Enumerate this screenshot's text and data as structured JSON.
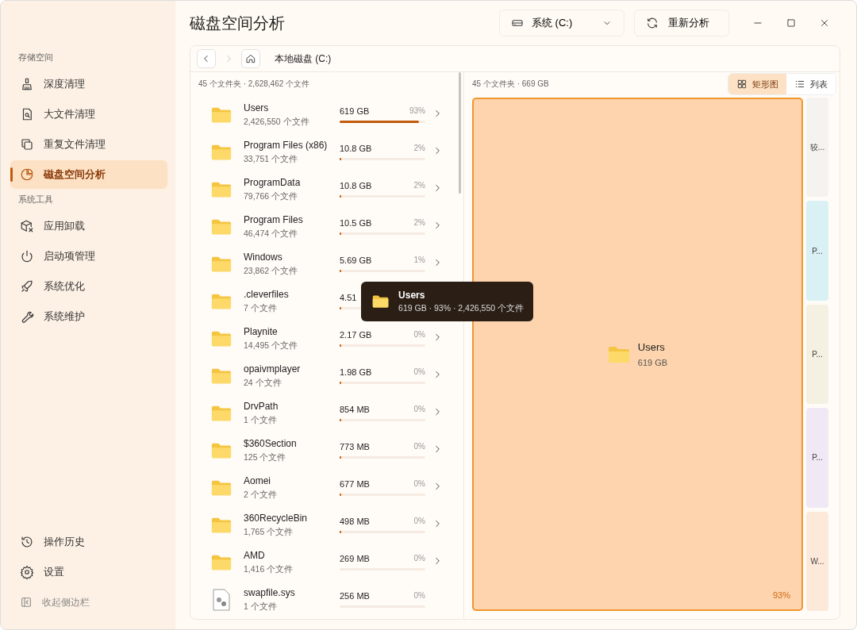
{
  "window": {
    "title": "磁盘空间分析"
  },
  "drive_select": {
    "value": "系统 (C:)"
  },
  "rescan_button": {
    "label": "重新分析"
  },
  "sidebar": {
    "sections": [
      {
        "header": "存储空间",
        "items": [
          {
            "label": "深度清理",
            "selected": false
          },
          {
            "label": "大文件清理",
            "selected": false
          },
          {
            "label": "重复文件清理",
            "selected": false
          },
          {
            "label": "磁盘空间分析",
            "selected": true
          }
        ]
      },
      {
        "header": "系统工具",
        "items": [
          {
            "label": "应用卸载",
            "selected": false
          },
          {
            "label": "启动项管理",
            "selected": false
          },
          {
            "label": "系统优化",
            "selected": false
          },
          {
            "label": "系统维护",
            "selected": false
          }
        ]
      }
    ],
    "footer_items": [
      {
        "label": "操作历史"
      },
      {
        "label": "设置"
      }
    ],
    "collapse": {
      "label": "收起侧边栏"
    }
  },
  "toolbar": {
    "back_disabled": false,
    "forward_disabled": true,
    "breadcrumb": "本地磁盘 (C:)"
  },
  "list_summary": "45 个文件夹 · 2,628,462 个文件",
  "rows": [
    {
      "kind": "folder",
      "name": "Users",
      "files": "2,426,550 个文件",
      "size": "619 GB",
      "percent": "93%",
      "level": 0.93
    },
    {
      "kind": "folder",
      "name": "Program Files (x86)",
      "files": "33,751 个文件",
      "size": "10.8 GB",
      "percent": "2%",
      "level": 0.02
    },
    {
      "kind": "folder",
      "name": "ProgramData",
      "files": "79,766 个文件",
      "size": "10.8 GB",
      "percent": "2%",
      "level": 0.02
    },
    {
      "kind": "folder",
      "name": "Program Files",
      "files": "46,474 个文件",
      "size": "10.5 GB",
      "percent": "2%",
      "level": 0.02
    },
    {
      "kind": "folder",
      "name": "Windows",
      "files": "23,862 个文件",
      "size": "5.69 GB",
      "percent": "1%",
      "level": 0.01
    },
    {
      "kind": "folder",
      "name": ".cleverfiles",
      "files": "7 个文件",
      "size": "4.51",
      "level": 0.01
    },
    {
      "kind": "folder",
      "name": "Playnite",
      "files": "14,495 个文件",
      "size": "2.17 GB",
      "percent": "0%",
      "level": 0.005
    },
    {
      "kind": "folder",
      "name": "opaivmplayer",
      "files": "24 个文件",
      "size": "1.98 GB",
      "percent": "0%",
      "level": 0.005
    },
    {
      "kind": "folder",
      "name": "DrvPath",
      "files": "1 个文件",
      "size": "854 MB",
      "percent": "0%",
      "level": 0.005
    },
    {
      "kind": "folder",
      "name": "$360Section",
      "files": "125 个文件",
      "size": "773 MB",
      "percent": "0%",
      "level": 0.005
    },
    {
      "kind": "folder",
      "name": "Aomei",
      "files": "2 个文件",
      "size": "677 MB",
      "percent": "0%",
      "level": 0.005
    },
    {
      "kind": "folder",
      "name": "360RecycleBin",
      "files": "1,765 个文件",
      "size": "498 MB",
      "percent": "0%",
      "level": 0.005
    },
    {
      "kind": "folder",
      "name": "AMD",
      "files": "1,416 个文件",
      "size": "269 MB",
      "percent": "0%",
      "level": 0
    },
    {
      "kind": "file",
      "name": "swapfile.sys",
      "files": "1 个文件",
      "size": "256 MB",
      "percent": "0%",
      "level": 0
    }
  ],
  "treemap": {
    "summary": "45 个文件夹 · 669 GB",
    "views": [
      {
        "label": "矩形图",
        "selected": true
      },
      {
        "label": "列表",
        "selected": false
      }
    ],
    "main": {
      "name": "Users",
      "size": "619 GB",
      "percent": "93%"
    },
    "blocks": [
      {
        "label": "较...",
        "color": "#f5f3f0"
      },
      {
        "label": "P...",
        "color": "#d9f0f4"
      },
      {
        "label": "P...",
        "color": "#f4f0e2"
      },
      {
        "label": "P...",
        "color": "#f1e8f5"
      },
      {
        "label": "W...",
        "color": "#fde9da"
      }
    ]
  },
  "tooltip": {
    "name": "Users",
    "details": "619 GB · 93% · 2,426,550 个文件"
  }
}
